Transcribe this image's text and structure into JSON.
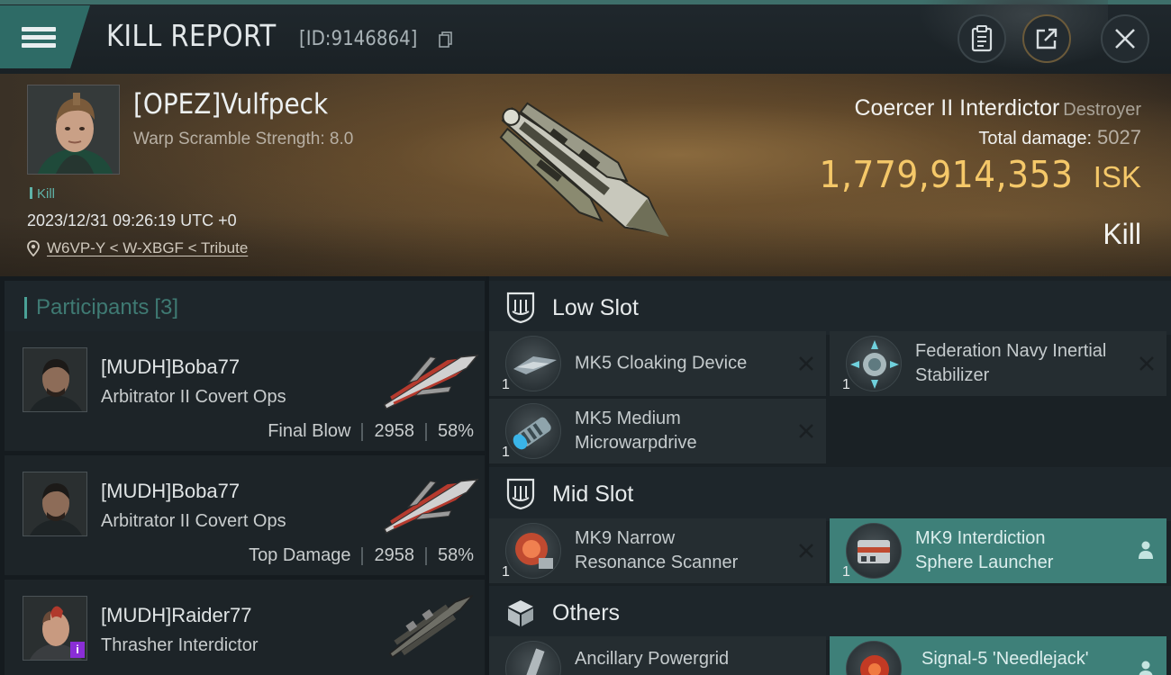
{
  "header": {
    "title": "KILL REPORT",
    "report_id": "[ID:9146864]"
  },
  "victim": {
    "name": "[OPEZ]Vulfpeck",
    "warp_scramble": "Warp Scramble Strength: 8.0",
    "tag": "Kill",
    "datetime": "2023/12/31 09:26:19 UTC +0",
    "location": "W6VP-Y < W-XBGF < Tribute",
    "ship_name": "Coercer II Interdictor",
    "ship_class": "Destroyer",
    "total_damage_label": "Total damage:",
    "total_damage": "5027",
    "isk_value": "1,779,914,353",
    "isk_unit": "ISK",
    "outcome": "Kill"
  },
  "participants": {
    "label": "Participants",
    "count": "[3]",
    "rows": [
      {
        "name": "[MUDH]Boba77",
        "ship": "Arbitrator II Covert Ops",
        "role": "Final Blow",
        "damage": "2958",
        "percent": "58%"
      },
      {
        "name": "[MUDH]Boba77",
        "ship": "Arbitrator II Covert Ops",
        "role": "Top Damage",
        "damage": "2958",
        "percent": "58%"
      },
      {
        "name": "[MUDH]Raider77",
        "ship": "Thrasher Interdictor",
        "badge": "i"
      }
    ]
  },
  "slots": {
    "low": {
      "label": "Low Slot",
      "items": [
        {
          "name": "MK5 Cloaking Device",
          "qty": "1"
        },
        {
          "name": "Federation Navy Inertial Stabilizer",
          "qty": "1"
        },
        {
          "name": "MK5 Medium Microwarpdrive",
          "qty": "1"
        }
      ]
    },
    "mid": {
      "label": "Mid Slot",
      "items": [
        {
          "name": "MK9 Narrow Resonance Scanner",
          "qty": "1"
        },
        {
          "name": "MK9 Interdiction Sphere Launcher",
          "qty": "1"
        }
      ]
    },
    "others": {
      "label": "Others",
      "items": [
        {
          "name": "Ancillary Powergrid"
        },
        {
          "name": "Signal-5 'Needlejack'"
        }
      ]
    }
  },
  "icons": {
    "menu": "hamburger-icon",
    "copy": "copy-icon",
    "clipboard": "clipboard-icon",
    "share": "share-icon",
    "close": "close-icon",
    "location": "location-pin-icon",
    "low_slot": "low-slot-icon",
    "mid_slot": "mid-slot-icon",
    "others": "cube-icon",
    "remove": "x-icon",
    "user": "person-icon"
  },
  "colors": {
    "accent_teal": "#3e8079",
    "isk_gold": "#f5c869",
    "kill_green": "#5fb3a8"
  }
}
